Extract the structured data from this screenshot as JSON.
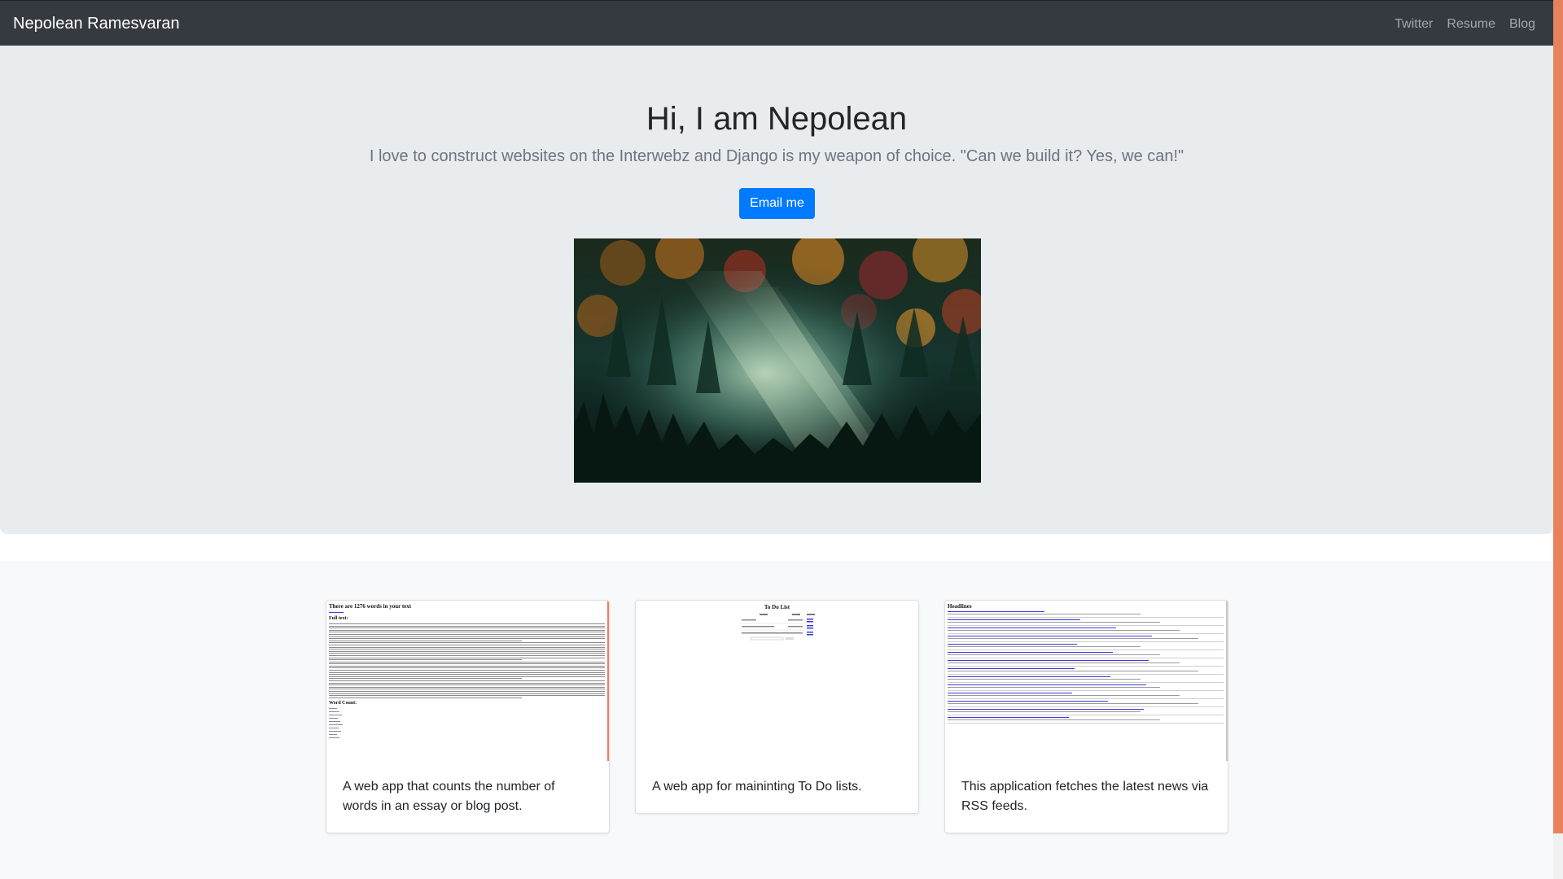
{
  "navbar": {
    "brand": "Nepolean Ramesvaran",
    "links": [
      "Twitter",
      "Resume",
      "Blog"
    ]
  },
  "hero": {
    "title": "Hi, I am Nepolean",
    "lead": "I love to construct websites on the Interwebz and Django is my weapon of choice. \"Can we build it? Yes, we can!\"",
    "button": "Email me"
  },
  "projects": [
    {
      "thumb_title": "There are 1276 words in your text",
      "thumb_sub1": "Full text:",
      "thumb_sub2": "Word Count:",
      "description": "A web app that counts the number of words in an essay or blog post."
    },
    {
      "thumb_title": "To Do List",
      "description": "A web app for maininting To Do lists."
    },
    {
      "thumb_title": "Headlines",
      "description": "This application fetches the latest news via RSS feeds."
    }
  ],
  "colors": {
    "navbar": "#343a40",
    "jumbotron": "#e9ecef",
    "primary": "#007bff",
    "scrollbar": "#e8825c"
  }
}
